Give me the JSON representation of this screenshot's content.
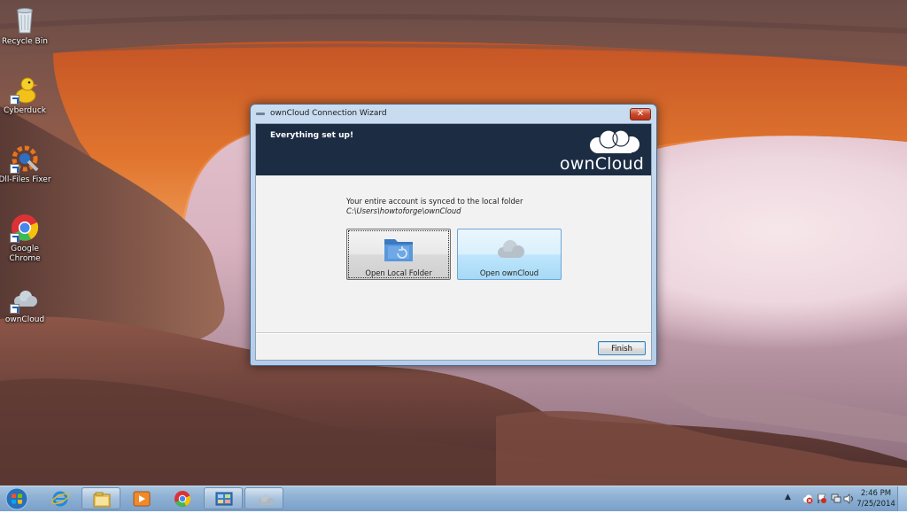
{
  "desktop": {
    "icons": [
      {
        "label": "Recycle Bin",
        "icon": "recycle-bin-icon"
      },
      {
        "label": "Cyberduck",
        "icon": "cyberduck-icon"
      },
      {
        "label": "Dll-Files Fixer",
        "icon": "dll-files-fixer-icon"
      },
      {
        "label": "Google Chrome",
        "icon": "chrome-icon"
      },
      {
        "label": "ownCloud",
        "icon": "owncloud-icon"
      }
    ]
  },
  "wizard": {
    "title": "ownCloud Connection Wizard",
    "close_glyph": "✕",
    "heading": "Everything set up!",
    "brand": "ownCloud",
    "message_prefix": "Your entire account is synced to the local folder ",
    "message_path": "C:\\Users\\howtoforge\\ownCloud",
    "open_local_folder_label": "Open Local Folder",
    "open_owncloud_label": "Open ownCloud",
    "finish_label": "Finish"
  },
  "taskbar": {
    "items": [
      {
        "icon": "windows-start-icon"
      },
      {
        "icon": "internet-explorer-icon"
      },
      {
        "icon": "file-explorer-icon"
      },
      {
        "icon": "media-player-icon"
      },
      {
        "icon": "chrome-icon"
      },
      {
        "icon": "control-panel-icon"
      },
      {
        "icon": "owncloud-icon"
      }
    ],
    "tray": {
      "chevron": "▲",
      "icons": [
        "owncloud-error-icon",
        "action-center-flag-icon",
        "network-icon",
        "volume-icon"
      ],
      "time": "2:46 PM",
      "date": "7/25/2014"
    }
  },
  "colors": {
    "wizard_header": "#1c2d43",
    "taskbar": "#8fb1d4",
    "close_button": "#c7482a"
  }
}
